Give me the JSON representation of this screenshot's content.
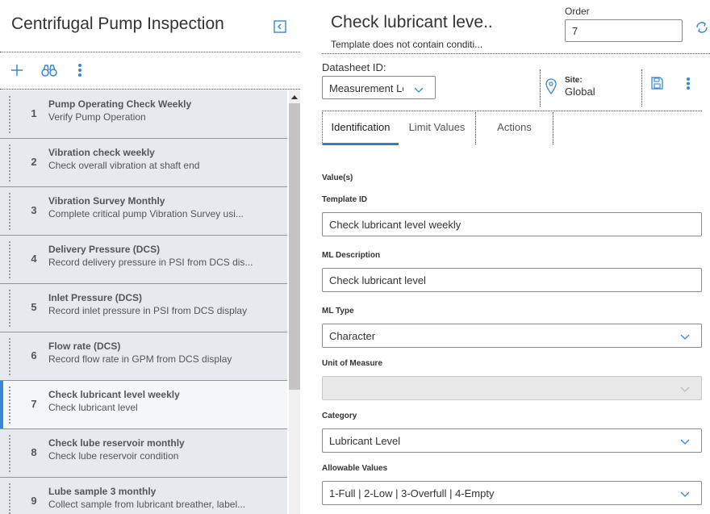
{
  "left_panel": {
    "title": "Centrifugal Pump Inspection",
    "items": [
      {
        "num": "1",
        "title": "Pump Operating Check Weekly",
        "subtitle": "Verify Pump Operation",
        "selected": false
      },
      {
        "num": "2",
        "title": "Vibration check weekly",
        "subtitle": "Check overall vibration at shaft end",
        "selected": false
      },
      {
        "num": "3",
        "title": "Vibration Survey Monthly",
        "subtitle": "Complete critical pump Vibration Survey usi...",
        "selected": false
      },
      {
        "num": "4",
        "title": "Delivery Pressure (DCS)",
        "subtitle": "Record delivery pressure in PSI from DCS dis...",
        "selected": false
      },
      {
        "num": "5",
        "title": "Inlet Pressure (DCS)",
        "subtitle": "Record inlet pressure in PSI from DCS display",
        "selected": false
      },
      {
        "num": "6",
        "title": "Flow rate (DCS)",
        "subtitle": "Record flow rate in GPM from DCS display",
        "selected": false
      },
      {
        "num": "7",
        "title": "Check lubricant level weekly",
        "subtitle": "Check lubricant level",
        "selected": true
      },
      {
        "num": "8",
        "title": "Check lube reservoir monthly",
        "subtitle": "Check lube reservoir condition",
        "selected": false
      },
      {
        "num": "9",
        "title": "Lube sample 3 monthly",
        "subtitle": "Collect sample from lubricant breather, label...",
        "selected": false
      }
    ]
  },
  "header": {
    "title": "Check lubricant leve..",
    "subtitle": "Template does not contain conditi...",
    "order_label": "Order",
    "order_value": "7"
  },
  "datasheet": {
    "label": "Datasheet ID:",
    "value": "Measurement Lo",
    "site_label": "Site:",
    "site_value": "Global"
  },
  "tabs": [
    {
      "label": "Identification",
      "active": true
    },
    {
      "label": "Limit Values",
      "active": false
    },
    {
      "label": "Actions",
      "active": false
    }
  ],
  "form": {
    "section_label": "Value(s)",
    "template_id_label": "Template ID",
    "template_id_value": "Check lubricant level weekly",
    "ml_description_label": "ML Description",
    "ml_description_value": "Check lubricant level",
    "ml_type_label": "ML Type",
    "ml_type_value": "Character",
    "uom_label": "Unit of Measure",
    "uom_value": "",
    "category_label": "Category",
    "category_value": "Lubricant Level",
    "allowable_label": "Allowable Values",
    "allowable_value": "1-Full | 2-Low | 3-Overfull | 4-Empty"
  },
  "colors": {
    "accent": "#3a86d6",
    "row_bg": "#e6e9ee",
    "selected_row_bg": "#f4f6f8",
    "tab_underline": "#2f7fc1"
  },
  "icons": [
    "add-icon",
    "binoculars-icon",
    "more-vertical-icon",
    "collapse-panel-icon",
    "refresh-icon",
    "chevron-down-icon",
    "location-pin-icon",
    "save-icon"
  ]
}
